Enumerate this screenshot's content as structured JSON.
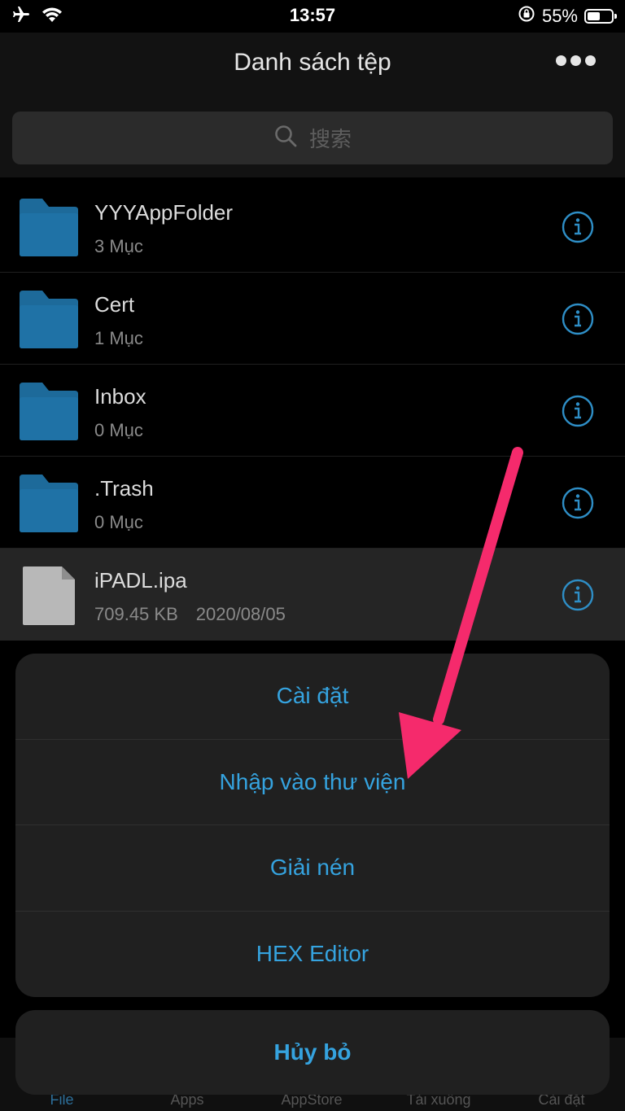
{
  "status": {
    "time": "13:57",
    "battery_percent": "55%",
    "battery_level": 0.55
  },
  "nav": {
    "title": "Danh sách tệp",
    "more_icon": "more-icon"
  },
  "search": {
    "placeholder": "搜索"
  },
  "files": [
    {
      "name": "YYYAppFolder",
      "meta": "3 Mục",
      "type": "folder"
    },
    {
      "name": "Cert",
      "meta": "1 Mục",
      "type": "folder"
    },
    {
      "name": "Inbox",
      "meta": "0 Mục",
      "type": "folder"
    },
    {
      "name": ".Trash",
      "meta": "0 Mục",
      "type": "folder"
    },
    {
      "name": "iPADL.ipa",
      "size": "709.45 KB",
      "date": "2020/08/05",
      "type": "file"
    }
  ],
  "action_sheet": {
    "items": [
      "Cài đặt",
      "Nhập vào thư viện",
      "Giải nén",
      "HEX Editor"
    ],
    "cancel": "Hủy bỏ"
  },
  "tabs": [
    "File",
    "Apps",
    "AppStore",
    "Tải xuống",
    "Cài đặt"
  ],
  "colors": {
    "accent": "#35a3df",
    "folder": "#1d6a9a",
    "arrow": "#f52a6c"
  }
}
